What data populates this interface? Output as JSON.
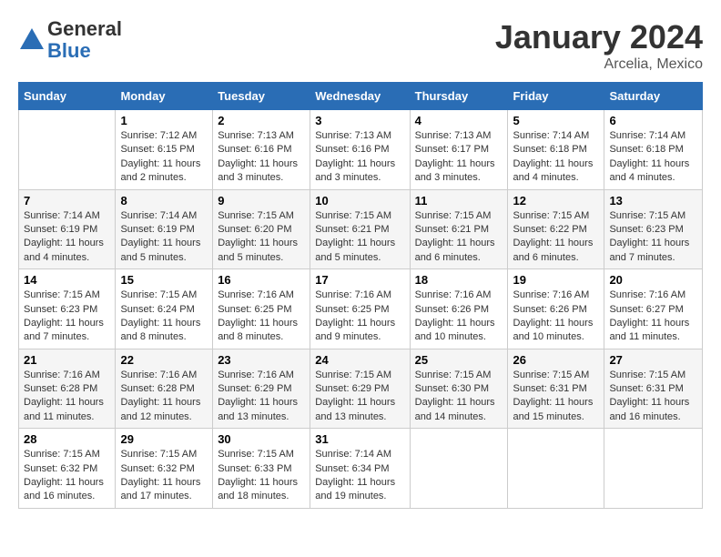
{
  "header": {
    "logo_line1": "General",
    "logo_line2": "Blue",
    "main_title": "January 2024",
    "subtitle": "Arcelia, Mexico"
  },
  "days_of_week": [
    "Sunday",
    "Monday",
    "Tuesday",
    "Wednesday",
    "Thursday",
    "Friday",
    "Saturday"
  ],
  "weeks": [
    [
      {
        "day": "",
        "info": ""
      },
      {
        "day": "1",
        "info": "Sunrise: 7:12 AM\nSunset: 6:15 PM\nDaylight: 11 hours\nand 2 minutes."
      },
      {
        "day": "2",
        "info": "Sunrise: 7:13 AM\nSunset: 6:16 PM\nDaylight: 11 hours\nand 3 minutes."
      },
      {
        "day": "3",
        "info": "Sunrise: 7:13 AM\nSunset: 6:16 PM\nDaylight: 11 hours\nand 3 minutes."
      },
      {
        "day": "4",
        "info": "Sunrise: 7:13 AM\nSunset: 6:17 PM\nDaylight: 11 hours\nand 3 minutes."
      },
      {
        "day": "5",
        "info": "Sunrise: 7:14 AM\nSunset: 6:18 PM\nDaylight: 11 hours\nand 4 minutes."
      },
      {
        "day": "6",
        "info": "Sunrise: 7:14 AM\nSunset: 6:18 PM\nDaylight: 11 hours\nand 4 minutes."
      }
    ],
    [
      {
        "day": "7",
        "info": "Sunrise: 7:14 AM\nSunset: 6:19 PM\nDaylight: 11 hours\nand 4 minutes."
      },
      {
        "day": "8",
        "info": "Sunrise: 7:14 AM\nSunset: 6:19 PM\nDaylight: 11 hours\nand 5 minutes."
      },
      {
        "day": "9",
        "info": "Sunrise: 7:15 AM\nSunset: 6:20 PM\nDaylight: 11 hours\nand 5 minutes."
      },
      {
        "day": "10",
        "info": "Sunrise: 7:15 AM\nSunset: 6:21 PM\nDaylight: 11 hours\nand 5 minutes."
      },
      {
        "day": "11",
        "info": "Sunrise: 7:15 AM\nSunset: 6:21 PM\nDaylight: 11 hours\nand 6 minutes."
      },
      {
        "day": "12",
        "info": "Sunrise: 7:15 AM\nSunset: 6:22 PM\nDaylight: 11 hours\nand 6 minutes."
      },
      {
        "day": "13",
        "info": "Sunrise: 7:15 AM\nSunset: 6:23 PM\nDaylight: 11 hours\nand 7 minutes."
      }
    ],
    [
      {
        "day": "14",
        "info": "Sunrise: 7:15 AM\nSunset: 6:23 PM\nDaylight: 11 hours\nand 7 minutes."
      },
      {
        "day": "15",
        "info": "Sunrise: 7:15 AM\nSunset: 6:24 PM\nDaylight: 11 hours\nand 8 minutes."
      },
      {
        "day": "16",
        "info": "Sunrise: 7:16 AM\nSunset: 6:25 PM\nDaylight: 11 hours\nand 8 minutes."
      },
      {
        "day": "17",
        "info": "Sunrise: 7:16 AM\nSunset: 6:25 PM\nDaylight: 11 hours\nand 9 minutes."
      },
      {
        "day": "18",
        "info": "Sunrise: 7:16 AM\nSunset: 6:26 PM\nDaylight: 11 hours\nand 10 minutes."
      },
      {
        "day": "19",
        "info": "Sunrise: 7:16 AM\nSunset: 6:26 PM\nDaylight: 11 hours\nand 10 minutes."
      },
      {
        "day": "20",
        "info": "Sunrise: 7:16 AM\nSunset: 6:27 PM\nDaylight: 11 hours\nand 11 minutes."
      }
    ],
    [
      {
        "day": "21",
        "info": "Sunrise: 7:16 AM\nSunset: 6:28 PM\nDaylight: 11 hours\nand 11 minutes."
      },
      {
        "day": "22",
        "info": "Sunrise: 7:16 AM\nSunset: 6:28 PM\nDaylight: 11 hours\nand 12 minutes."
      },
      {
        "day": "23",
        "info": "Sunrise: 7:16 AM\nSunset: 6:29 PM\nDaylight: 11 hours\nand 13 minutes."
      },
      {
        "day": "24",
        "info": "Sunrise: 7:15 AM\nSunset: 6:29 PM\nDaylight: 11 hours\nand 13 minutes."
      },
      {
        "day": "25",
        "info": "Sunrise: 7:15 AM\nSunset: 6:30 PM\nDaylight: 11 hours\nand 14 minutes."
      },
      {
        "day": "26",
        "info": "Sunrise: 7:15 AM\nSunset: 6:31 PM\nDaylight: 11 hours\nand 15 minutes."
      },
      {
        "day": "27",
        "info": "Sunrise: 7:15 AM\nSunset: 6:31 PM\nDaylight: 11 hours\nand 16 minutes."
      }
    ],
    [
      {
        "day": "28",
        "info": "Sunrise: 7:15 AM\nSunset: 6:32 PM\nDaylight: 11 hours\nand 16 minutes."
      },
      {
        "day": "29",
        "info": "Sunrise: 7:15 AM\nSunset: 6:32 PM\nDaylight: 11 hours\nand 17 minutes."
      },
      {
        "day": "30",
        "info": "Sunrise: 7:15 AM\nSunset: 6:33 PM\nDaylight: 11 hours\nand 18 minutes."
      },
      {
        "day": "31",
        "info": "Sunrise: 7:14 AM\nSunset: 6:34 PM\nDaylight: 11 hours\nand 19 minutes."
      },
      {
        "day": "",
        "info": ""
      },
      {
        "day": "",
        "info": ""
      },
      {
        "day": "",
        "info": ""
      }
    ]
  ]
}
